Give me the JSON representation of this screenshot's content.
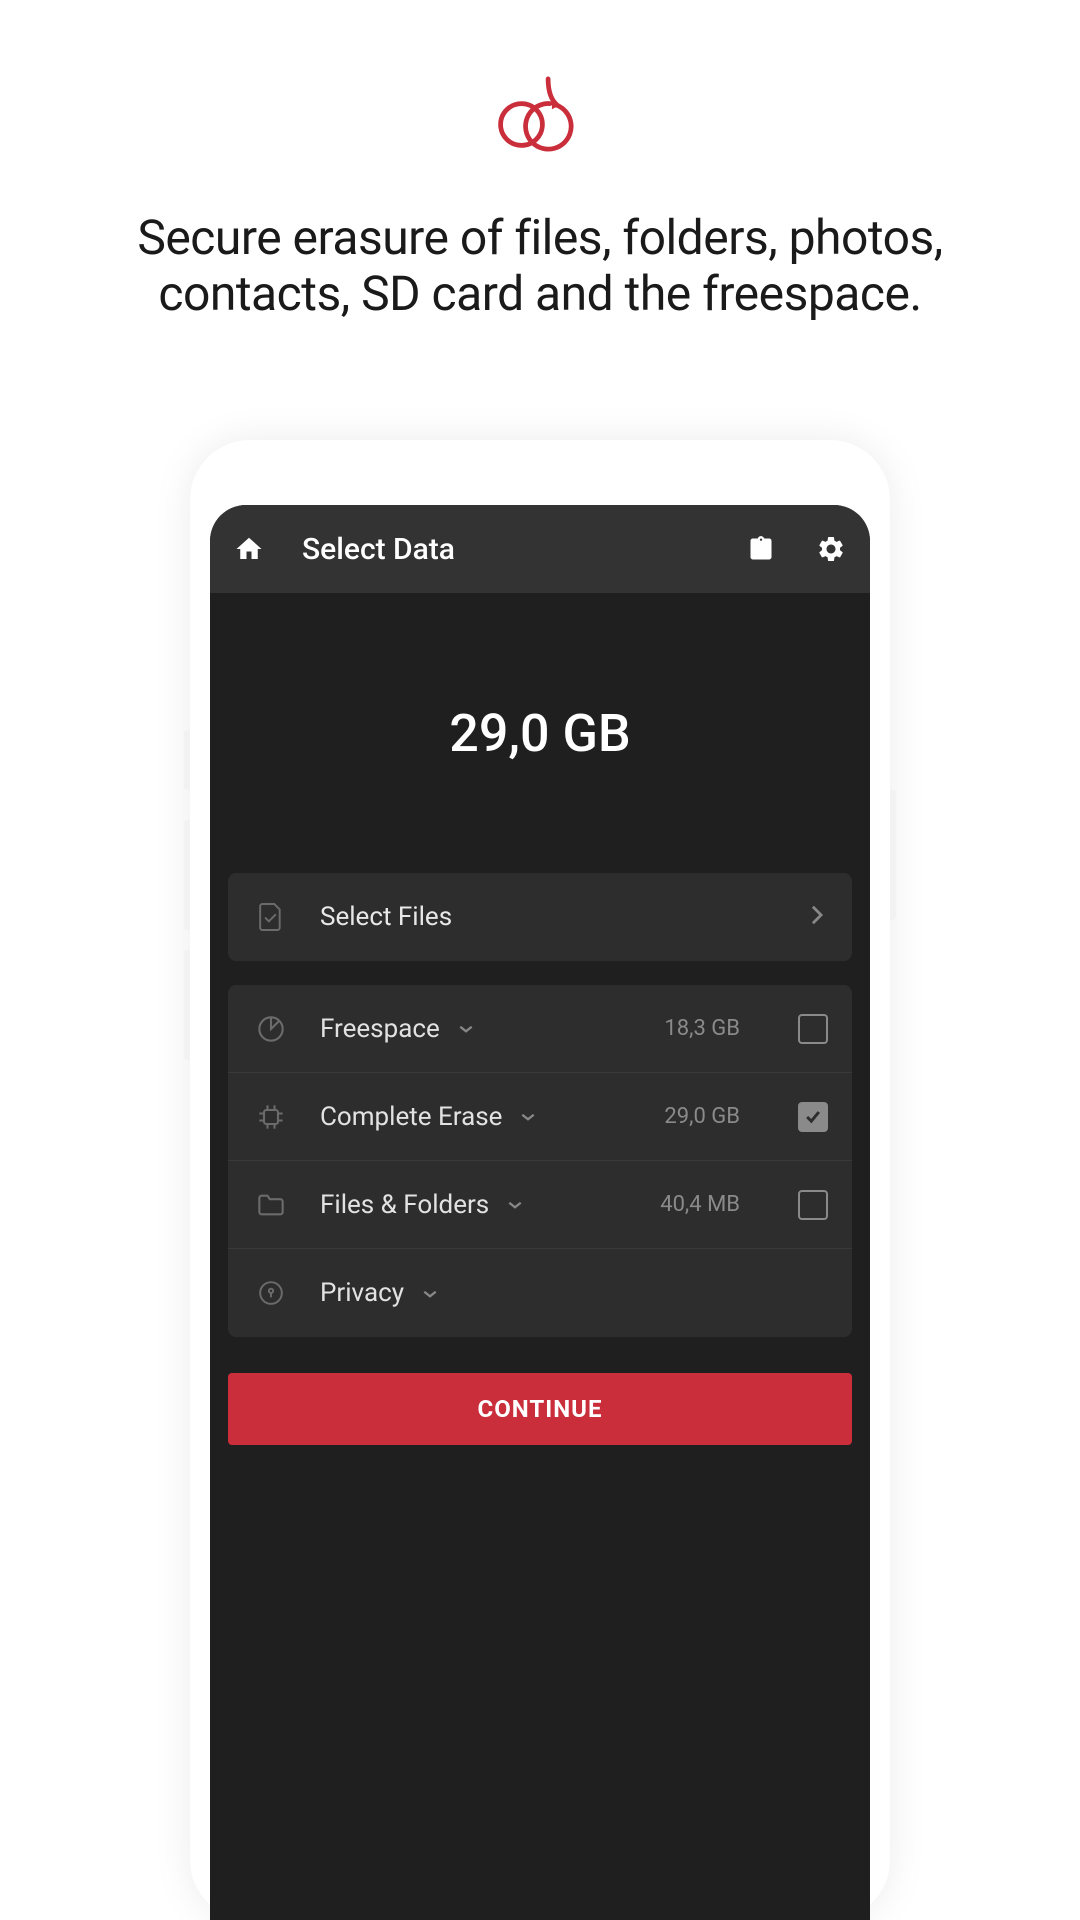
{
  "brand": {
    "accent": "#c92e3a"
  },
  "tagline": "Secure erasure of files, folders, photos, contacts, SD card and the freespace.",
  "appbar": {
    "title": "Select Data",
    "home_icon": "home-icon",
    "clipboard_icon": "clipboard-icon",
    "settings_icon": "gear-icon"
  },
  "hero": {
    "size_label": "29,0 GB"
  },
  "select_files": {
    "label": "Select Files"
  },
  "options": [
    {
      "icon": "pie-icon",
      "label": "Freespace",
      "size": "18,3 GB",
      "checked": false
    },
    {
      "icon": "chip-icon",
      "label": "Complete Erase",
      "size": "29,0 GB",
      "checked": true
    },
    {
      "icon": "folder-icon",
      "label": "Files & Folders",
      "size": "40,4 MB",
      "checked": false
    },
    {
      "icon": "lock-icon",
      "label": "Privacy",
      "size": "",
      "checked": null
    }
  ],
  "continue": {
    "label": "CONTINUE"
  }
}
